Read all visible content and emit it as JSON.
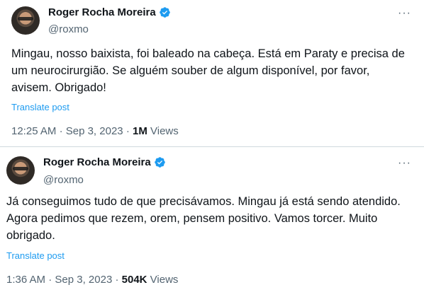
{
  "colors": {
    "accent": "#1d9bf0",
    "secondary_text": "#536471",
    "primary_text": "#0f1419",
    "divider": "#cfd9de"
  },
  "tweets": [
    {
      "author_name": "Roger Rocha Moreira",
      "handle": "@roxmo",
      "verified_icon": "verified-badge-icon",
      "more_icon": "more-options-icon",
      "more_label": "···",
      "text": "Mingau, nosso baixista, foi baleado na cabeça. Está em Paraty e precisa de um neurocirurgião. Se alguém souber de algum disponível, por favor, avisem. Obrigado!",
      "translate_label": "Translate post",
      "time": "12:25 AM",
      "date": "Sep 3, 2023",
      "views_count": "1M",
      "views_label": "Views"
    },
    {
      "author_name": "Roger Rocha Moreira",
      "handle": "@roxmo",
      "verified_icon": "verified-badge-icon",
      "more_icon": "more-options-icon",
      "more_label": "···",
      "text": "Já conseguimos tudo de que precisávamos. Mingau já está sendo atendido. Agora pedimos que rezem, orem, pensem positivo. Vamos torcer. Muito obrigado.",
      "translate_label": "Translate post",
      "time": "1:36 AM",
      "date": "Sep 3, 2023",
      "views_count": "504K",
      "views_label": "Views"
    }
  ],
  "separator": "·"
}
